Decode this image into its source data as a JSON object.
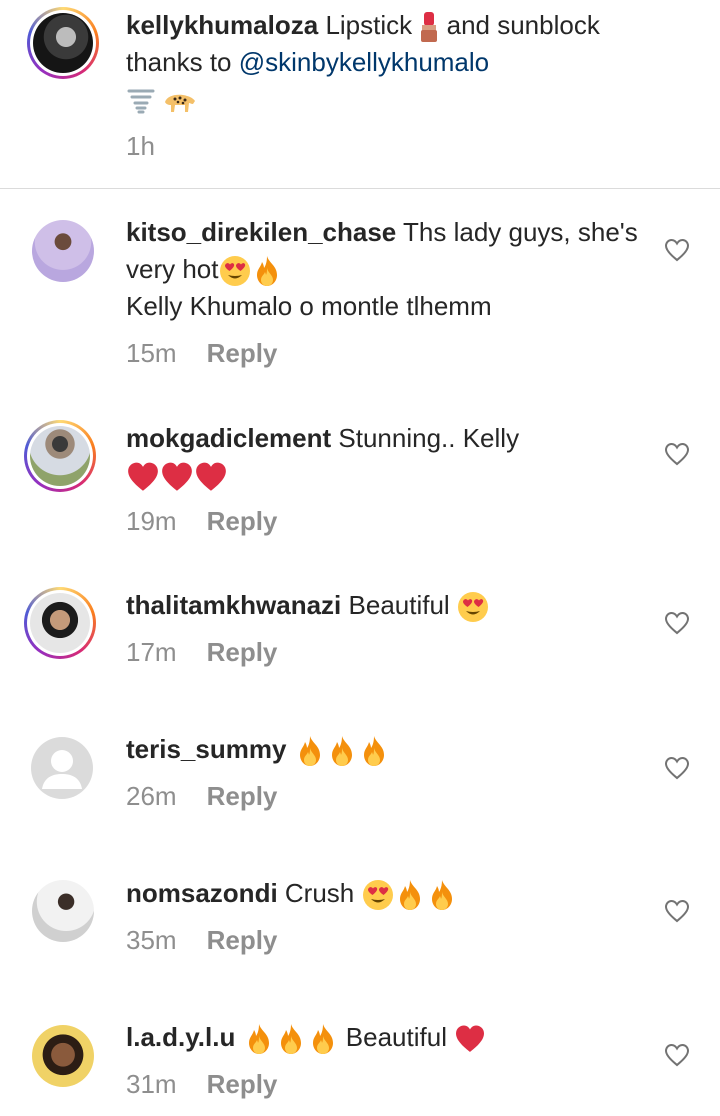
{
  "caption": {
    "username": "kellykhumaloza",
    "text_before": "Lipstick",
    "text_middle": "and sunblock thanks to",
    "mention": "@skinbykellykhumalo",
    "time": "1h"
  },
  "comments": [
    {
      "username": "kitso_direkilen_chase",
      "text": "Ths lady guys, she's very hot",
      "text2": "Kelly Khumalo o montle tlhemm",
      "time": "15m",
      "reply": "Reply"
    },
    {
      "username": "mokgadiclement",
      "text": "Stunning.. Kelly",
      "time": "19m",
      "reply": "Reply"
    },
    {
      "username": "thalitamkhwanazi",
      "text": "Beautiful",
      "time": "17m",
      "reply": "Reply"
    },
    {
      "username": "teris_summy",
      "text": "",
      "time": "26m",
      "reply": "Reply"
    },
    {
      "username": "nomsazondi",
      "text": "Crush",
      "time": "35m",
      "reply": "Reply"
    },
    {
      "username": "l.a.d.y.l.u",
      "text": "Beautiful",
      "time": "31m",
      "reply": "Reply"
    }
  ],
  "icons": {
    "like": "heart-outline-icon",
    "fire": "fire-emoji",
    "heart_eyes": "heart-eyes-emoji",
    "red_heart": "red-heart-emoji",
    "lipstick": "lipstick-emoji",
    "tornado": "tornado-emoji",
    "leopard": "leopard-emoji"
  }
}
